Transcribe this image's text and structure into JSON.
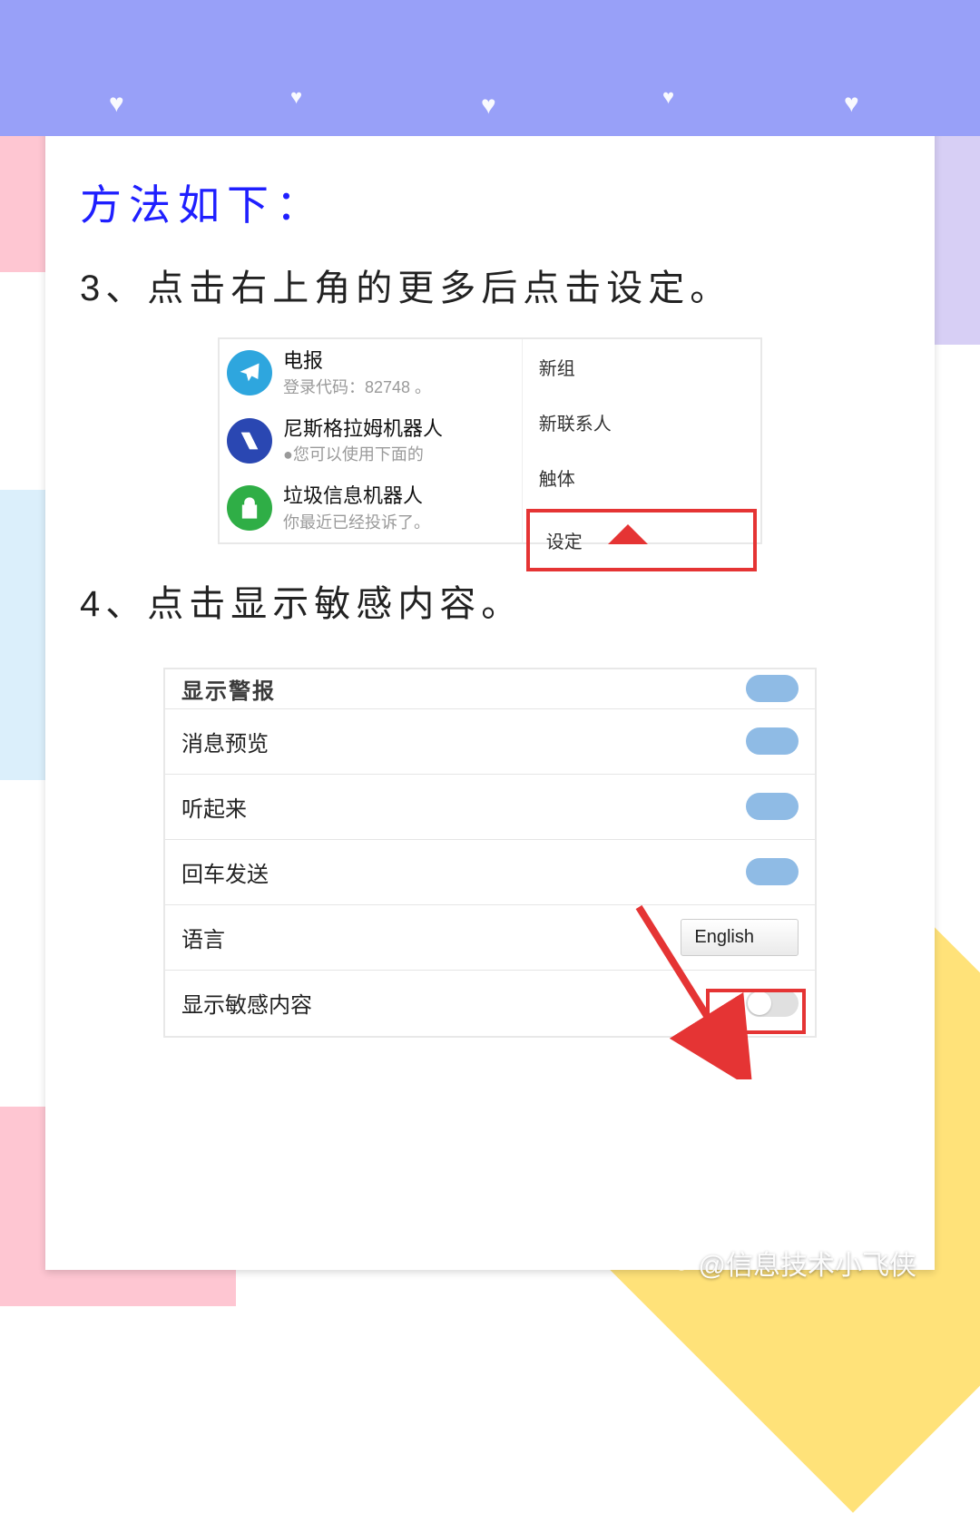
{
  "title": "方法如下：",
  "step3": "3、点击右上角的更多后点击设定。",
  "step4": "4、点击显示敏感内容。",
  "chats": {
    "item0_title": "电报",
    "item0_sub": "登录代码：82748 。",
    "item1_title": "尼斯格拉姆机器人",
    "item1_sub": "●您可以使用下面的",
    "item2_title": "垃圾信息机器人",
    "item2_sub": "你最近已经投诉了。"
  },
  "drop": {
    "i0": "新组",
    "i1": "新联系人",
    "i2": "触体",
    "i3": "设定"
  },
  "settings": {
    "row_top": "显示警报",
    "row0": "消息预览",
    "row1": "听起来",
    "row2": "回车发送",
    "row3": "语言",
    "row4": "显示敏感内容",
    "lang_value": "English"
  },
  "watermark": "@信息技术小飞侠"
}
